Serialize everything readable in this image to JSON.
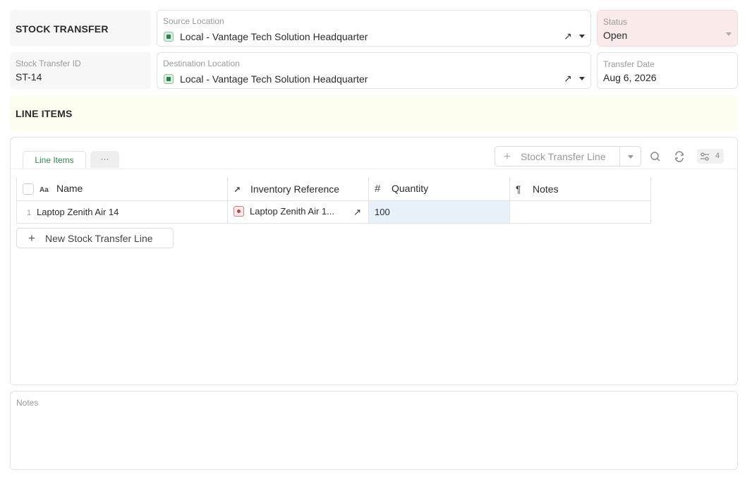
{
  "header": {
    "title": "STOCK TRANSFER",
    "source": {
      "label": "Source Location",
      "value": "Local - Vantage Tech Solution Headquarter"
    },
    "status": {
      "label": "Status",
      "value": "Open"
    },
    "id": {
      "label": "Stock Transfer ID",
      "value": "ST-14"
    },
    "destination": {
      "label": "Destination Location",
      "value": "Local - Vantage Tech Solution Headquarter"
    },
    "date": {
      "label": "Transfer Date",
      "value": "Aug 6, 2026"
    }
  },
  "line_items_heading": "LINE ITEMS",
  "tabs": {
    "active": "Line Items",
    "more": "···"
  },
  "toolbar": {
    "add_label": "Stock Transfer Line",
    "field_count": "4"
  },
  "columns": {
    "name": {
      "icon": "Aa",
      "label": "Name"
    },
    "inventory": {
      "icon": "↗",
      "label": "Inventory Reference"
    },
    "quantity": {
      "icon": "#",
      "label": "Quantity"
    },
    "notes": {
      "icon": "¶",
      "label": "Notes"
    }
  },
  "rows": [
    {
      "num": "1",
      "name": "Laptop Zenith Air 14",
      "inventory": "Laptop Zenith Air 1...",
      "quantity": "100",
      "notes": ""
    }
  ],
  "new_line_button": "New Stock Transfer Line",
  "notes_field": {
    "label": "Notes",
    "value": ""
  },
  "colors": {
    "status_bg": "#fbeaea",
    "line_items_bg": "#fdfdf0",
    "quantity_bg": "#e9f1f8",
    "accent": "#2f8a4e"
  },
  "icons": [
    "location-icon",
    "external-link-icon",
    "chevron-down-icon",
    "plus-icon",
    "search-icon",
    "refresh-icon",
    "settings-sliders-icon",
    "checkbox-icon",
    "inventory-icon"
  ]
}
